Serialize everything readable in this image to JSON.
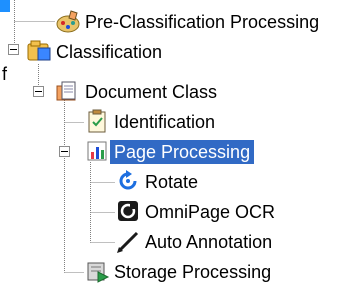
{
  "tree": {
    "edge_fragment": "f",
    "nodes": [
      {
        "key": "pre",
        "label": "Pre-Classification Processing",
        "icon": "palette-icon"
      },
      {
        "key": "classification",
        "label": "Classification",
        "icon": "classification-folder-icon",
        "expanded": true
      },
      {
        "key": "docclass",
        "label": "Document Class",
        "icon": "document-folder-icon",
        "expanded": true
      },
      {
        "key": "identification",
        "label": "Identification",
        "icon": "clipboard-check-icon"
      },
      {
        "key": "pageproc",
        "label": "Page Processing",
        "icon": "bar-chart-icon",
        "expanded": true,
        "selected": true
      },
      {
        "key": "rotate",
        "label": "Rotate",
        "icon": "rotate-icon"
      },
      {
        "key": "omnipage",
        "label": "OmniPage OCR",
        "icon": "omnipage-icon"
      },
      {
        "key": "autoann",
        "label": "Auto Annotation",
        "icon": "pencil-icon"
      },
      {
        "key": "storage",
        "label": "Storage Processing",
        "icon": "storage-icon"
      }
    ]
  },
  "colors": {
    "selection": "#316ac5",
    "tree_line": "#808080"
  }
}
